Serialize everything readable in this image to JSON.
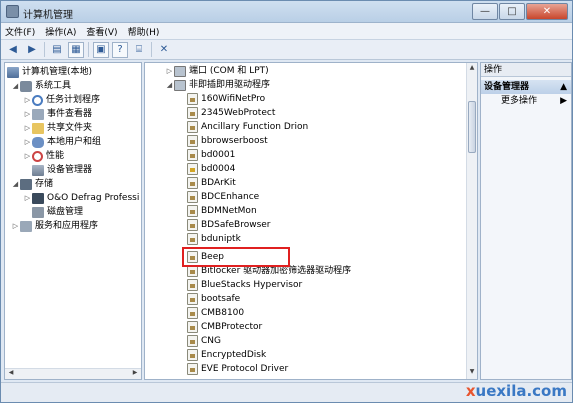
{
  "window": {
    "title": "计算机管理",
    "controls": {
      "minimize": "—",
      "maximize": "□",
      "close": "✕"
    }
  },
  "menu": [
    "文件(F)",
    "操作(A)",
    "查看(V)",
    "帮助(H)"
  ],
  "toolbar": {
    "icons": [
      "back-icon",
      "forward-icon",
      "folder-up-icon",
      "show-hide-tree-icon",
      "properties-icon",
      "help-icon",
      "scan-hardware-icon",
      "uninstall-icon"
    ]
  },
  "tree": {
    "root": "计算机管理(本地)",
    "system_tools": "系统工具",
    "task_scheduler": "任务计划程序",
    "event_viewer": "事件查看器",
    "shared_folders": "共享文件夹",
    "local_users": "本地用户和组",
    "performance": "性能",
    "device_manager": "设备管理器",
    "storage": "存储",
    "defrag": "O&O Defrag Professi",
    "disk_mgmt": "磁盘管理",
    "services": "服务和应用程序"
  },
  "devices": {
    "ports": "端口 (COM 和 LPT)",
    "nonpnp": "非即插即用驱动程序",
    "drivers": [
      "160WifiNetPro",
      "2345WebProtect",
      "Ancillary Function Drion",
      "bbrowserboost",
      "bd0001",
      "bd0004",
      "BDArKit",
      "BDCEnhance",
      "BDMNetMon",
      "BDSafeBrowser",
      "bduniptk",
      "Beep",
      "Bitlocker 驱动器加密筛选器驱动程序",
      "BlueStacks Hypervisor",
      "bootsafe",
      "CMB8100",
      "CMBProtector",
      "CNG",
      "EncryptedDisk",
      "EVE Protocol Driver"
    ],
    "selected": "Beep"
  },
  "actions": {
    "header": "操作",
    "section": "设备管理器",
    "more": "更多操作"
  },
  "watermark": {
    "first": "x",
    "rest": "uexila.com"
  }
}
